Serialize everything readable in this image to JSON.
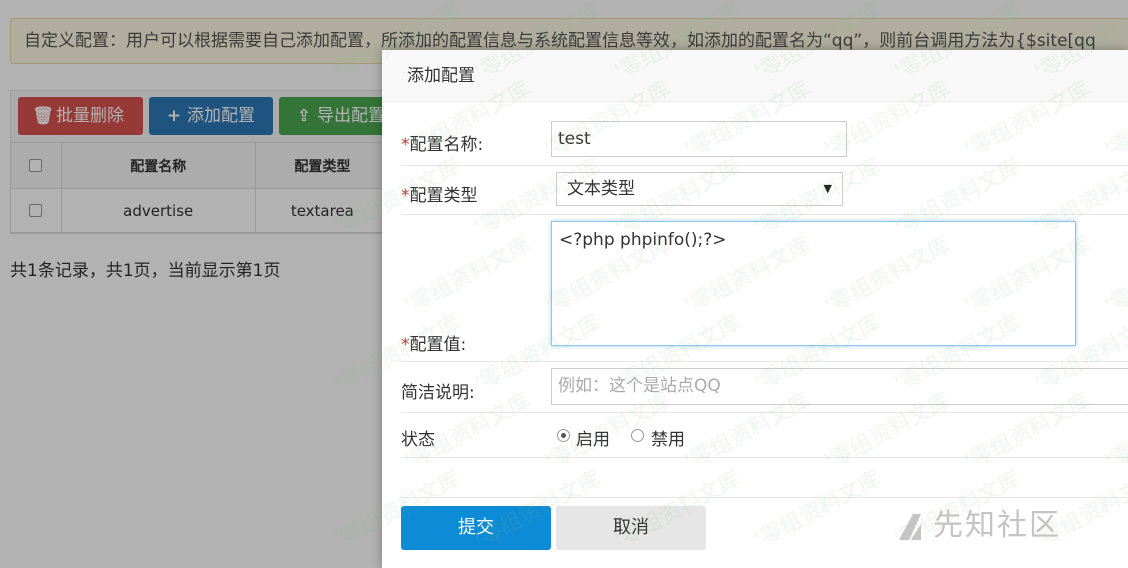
{
  "notice": {
    "text": "自定义配置：用户可以根据需要自己添加配置，所添加的配置信息与系统配置信息等效，如添加的配置名为“qq”，则前台调用方法为{$site[qq"
  },
  "toolbar": {
    "batch_delete": "批量删除",
    "add_config": "添加配置",
    "export_config": "导出配置",
    "icons": {
      "delete": "trash-icon",
      "add": "plus-icon",
      "export": "export-icon"
    },
    "colors": {
      "delete": "#d9534f",
      "add": "#2f79b8",
      "export": "#4ca652"
    }
  },
  "table": {
    "headers": [
      "配置名称",
      "配置类型"
    ],
    "rows": [
      {
        "name": "advertise",
        "type": "textarea"
      }
    ]
  },
  "pagination": {
    "summary": "共1条记录，共1页，当前显示第1页"
  },
  "modal": {
    "title": "添加配置",
    "required_mark": "*",
    "fields": {
      "name": {
        "label": "配置名称:",
        "value": "test"
      },
      "type": {
        "label": "配置类型",
        "value": "文本类型"
      },
      "value": {
        "label": "配置值:",
        "value": "<?php phpinfo();?>"
      },
      "desc": {
        "label": "简洁说明:",
        "placeholder": "例如：这个是站点QQ"
      },
      "status": {
        "label": "状态",
        "options": [
          "启用",
          "禁用"
        ],
        "selected": "启用"
      }
    },
    "submit": "提交",
    "cancel": "取消",
    "colors": {
      "submit": "#0e8bd6",
      "cancel": "#e6e6e6"
    }
  },
  "watermark": {
    "text": "零组资料文库",
    "logo_text": "先知社区"
  }
}
